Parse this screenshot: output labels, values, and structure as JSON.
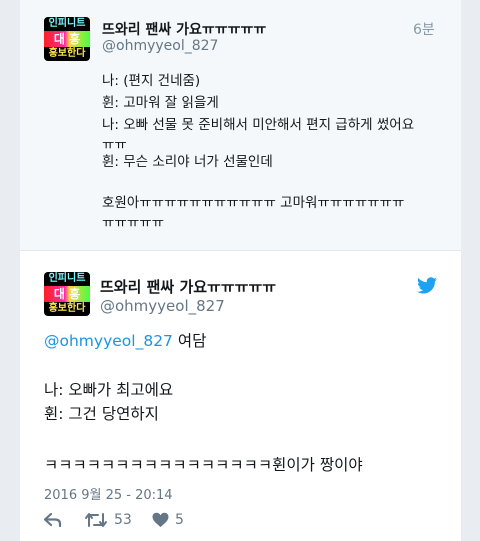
{
  "tweet1": {
    "avatar": {
      "top": "인피니트",
      "middle": "대 흥",
      "bottom": "홍보한다"
    },
    "name": "뜨와리 팬싸 가요ㅠㅠㅠㅠㅠ",
    "handle": "@ohmyyeol_827",
    "time": "6분",
    "lines": [
      "나: (편지 건네줌)",
      "휜: 고마워 잘 읽을게",
      "나: 오빠 선물 못 준비해서 미안해서 편지 급하게 썼어요",
      "ㅠㅠ",
      "휜: 무슨 소리야 너가 선물인데",
      "호원아ㅠㅠㅠㅠㅠㅠㅠㅠㅠㅠㅠ 고마워ㅠㅠㅠㅠㅠㅠㅠ",
      "ㅠㅠㅠㅠㅠ"
    ]
  },
  "tweet2": {
    "avatar": {
      "top": "인피니트",
      "middle": "대 흥",
      "bottom": "홍보한다"
    },
    "name": "뜨와리 팬싸 가요ㅠㅠㅠㅠㅠ",
    "handle": "@ohmyyeol_827",
    "mention": "@ohmyyeol_827",
    "reply_text": " 여담",
    "lines": [
      "나: 오빠가 최고에요",
      "휜: 그건 당연하지",
      "ㅋㅋㅋㅋㅋㅋㅋㅋㅋㅋㅋㅋㅋㅋㅋㅋ휜이가 짱이야"
    ],
    "timestamp": "2016 9월 25 - 20:14",
    "retweets": "53",
    "likes": "5"
  },
  "colors": {
    "link": "#1b95e0",
    "twitter_blue": "#1da1f2",
    "muted": "#657786"
  },
  "icons": [
    "reply-icon",
    "retweet-icon",
    "like-icon",
    "twitter-bird-icon"
  ]
}
